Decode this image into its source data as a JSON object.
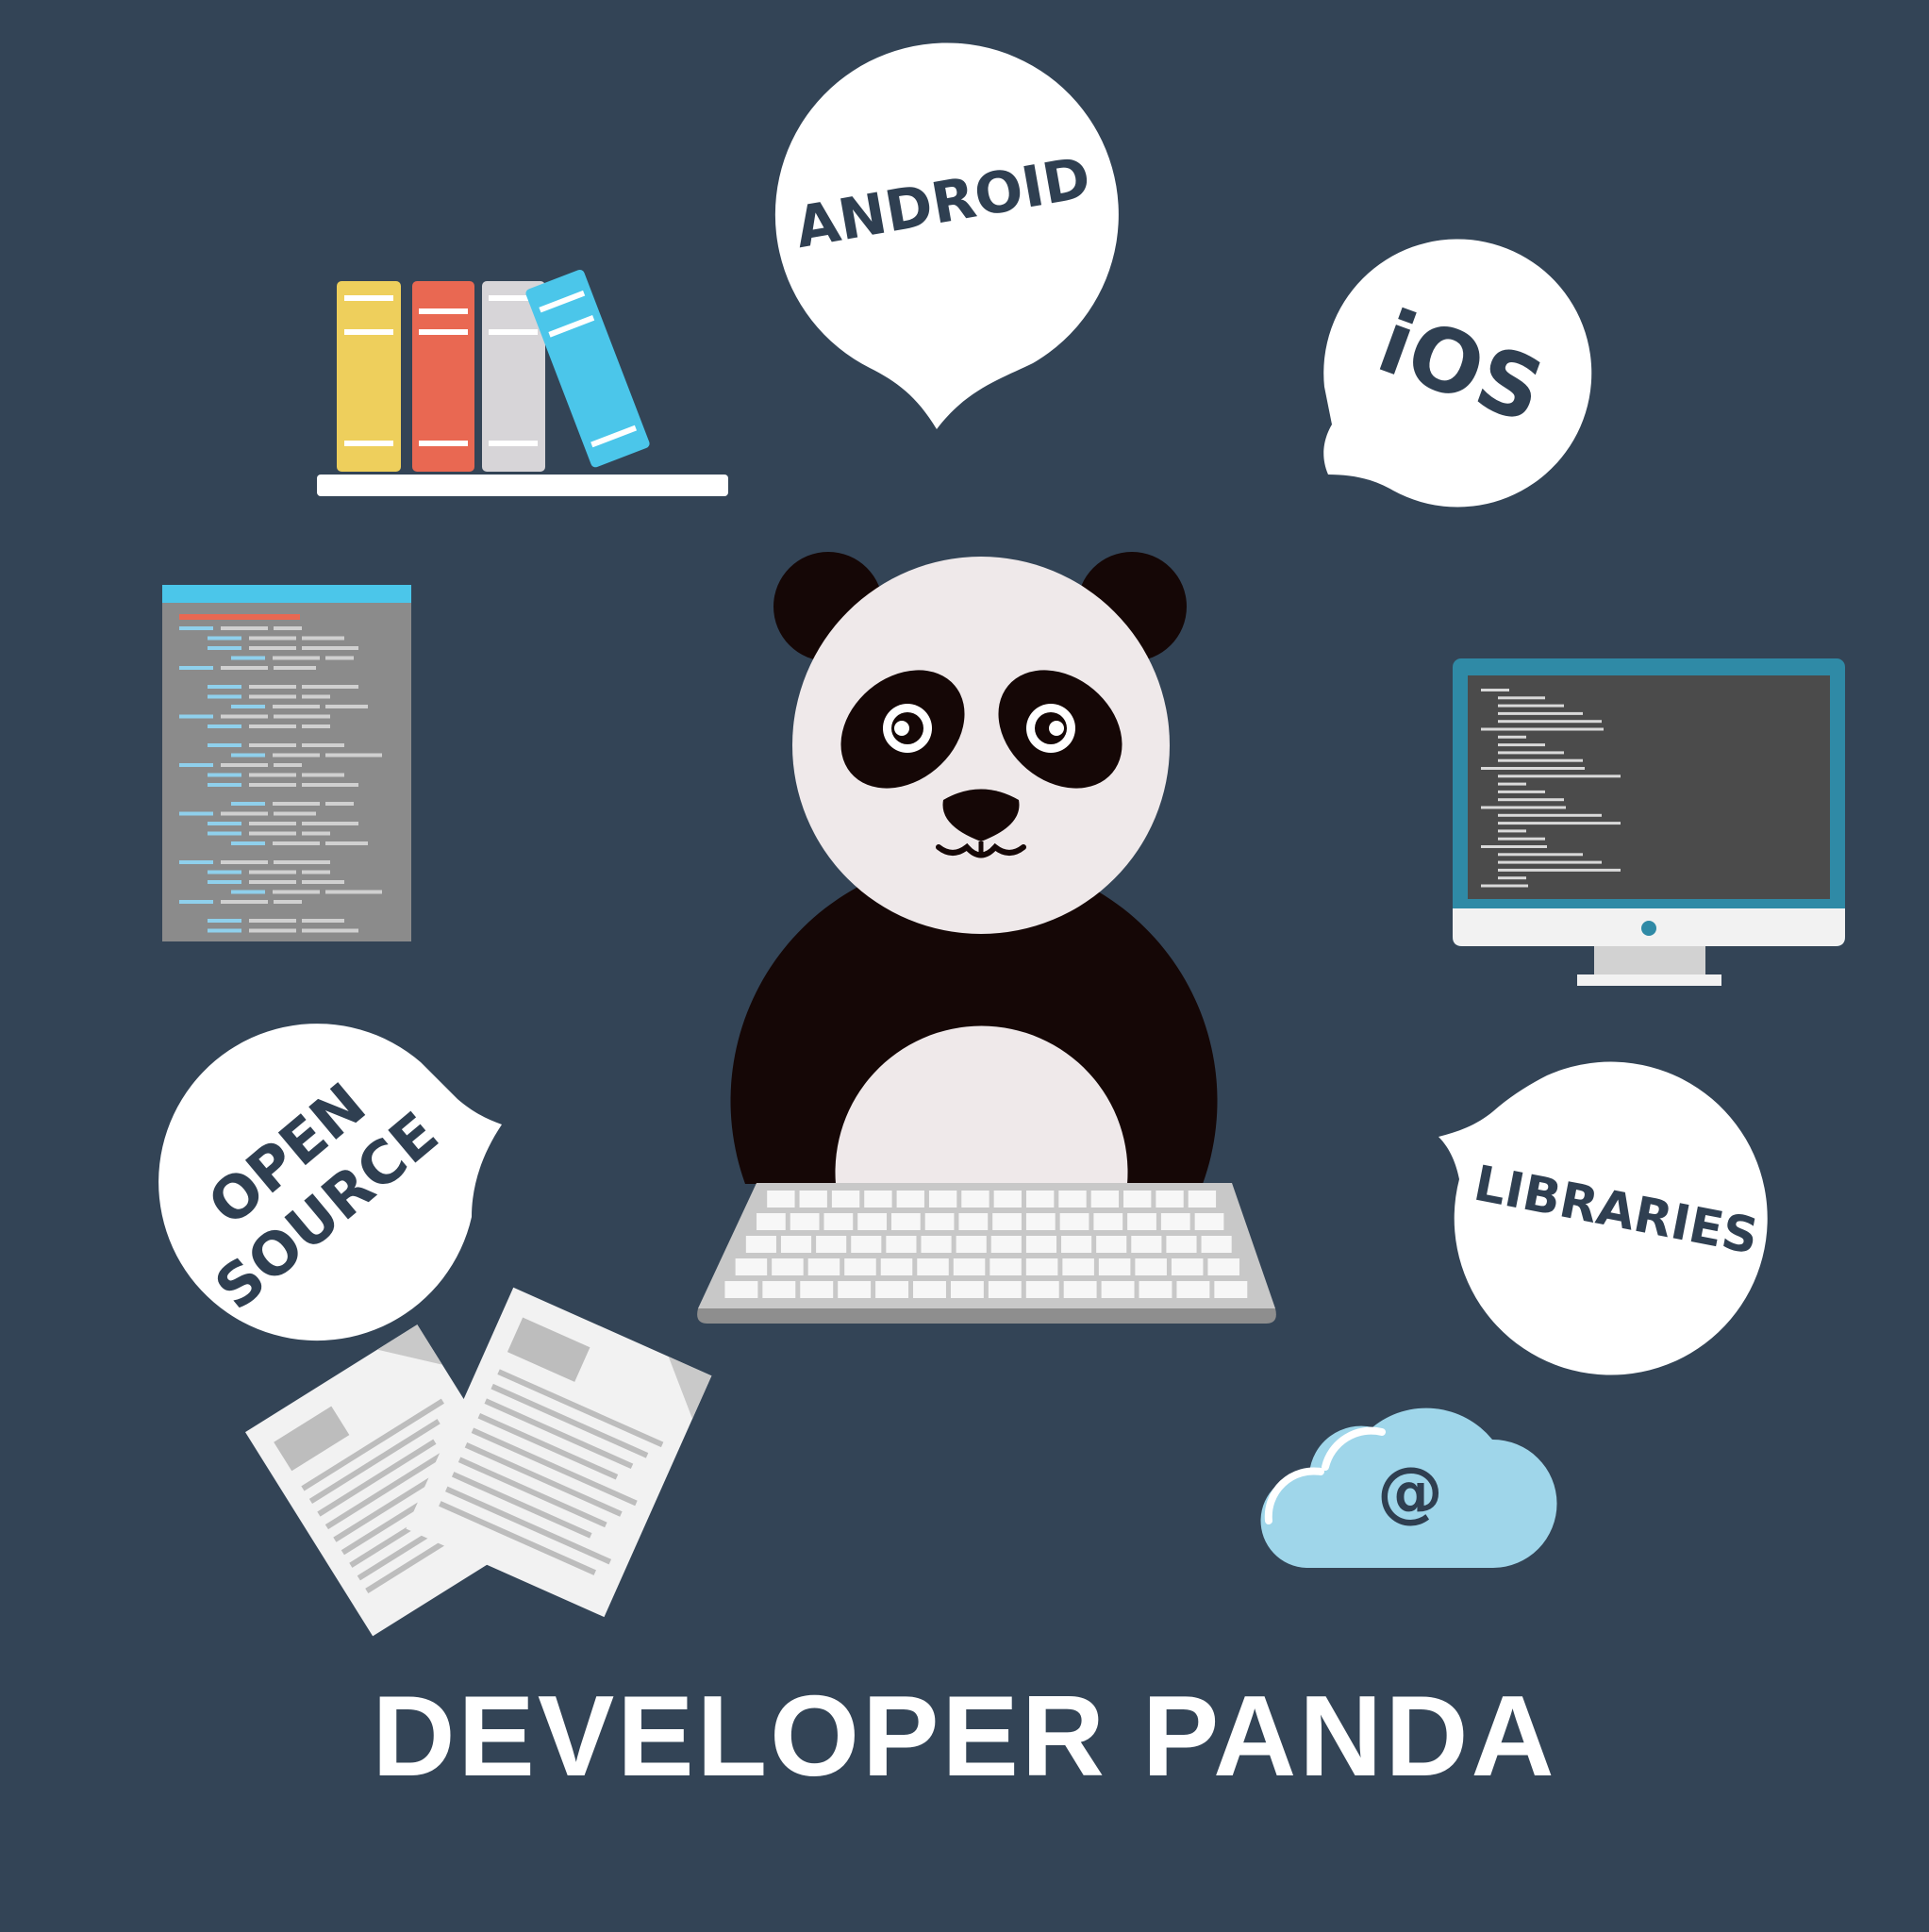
{
  "colors": {
    "background": "#334456",
    "bubble": "#ffffff",
    "bubble_text": "#2f3f51",
    "panda_black": "#150706",
    "panda_white": "#efe9ea",
    "book_yellow": "#eecf5c",
    "book_red": "#e96852",
    "book_grey": "#d7d5d8",
    "book_blue": "#4bc6ea",
    "cloud": "#9fd6ea",
    "monitor_frame": "#2f8aa6",
    "code_panel": "#8b8b8b"
  },
  "bubbles": {
    "android": "ANDROID",
    "ios": "iOS",
    "open": "OPEN",
    "source": "SOURCE",
    "libraries": "LIBRARIES"
  },
  "cloud": {
    "symbol": "@"
  },
  "title": "DEVELOPER PANDA",
  "icons": [
    "bookshelf-icon",
    "code-document-icon",
    "monitor-icon",
    "newspaper-icon",
    "cloud-email-icon",
    "keyboard-icon",
    "panda-mascot"
  ]
}
